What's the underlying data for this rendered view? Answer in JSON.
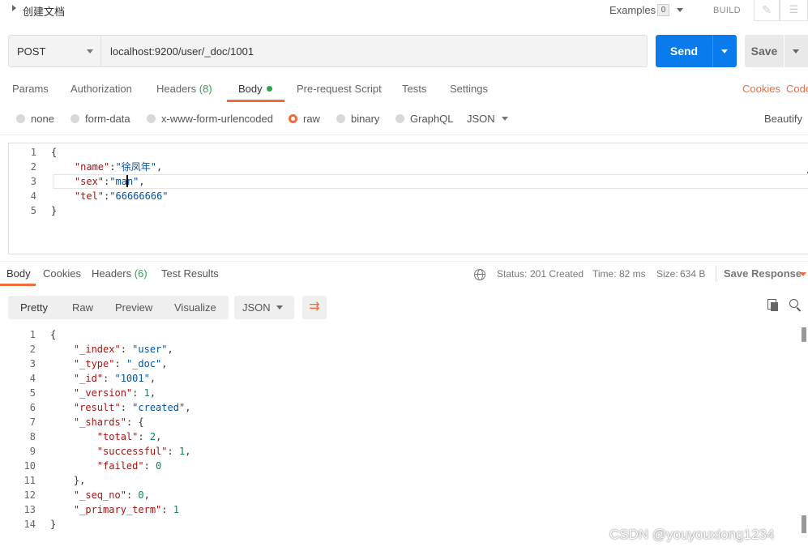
{
  "topbar": {
    "request_name": "创建文档",
    "examples_label": "Examples",
    "examples_count": "0",
    "build_label": "BUILD"
  },
  "request": {
    "method": "POST",
    "url": "localhost:9200/user/_doc/1001",
    "send_label": "Send",
    "save_label": "Save"
  },
  "request_tabs": {
    "params": "Params",
    "authorization": "Authorization",
    "headers": "Headers",
    "headers_count": "(8)",
    "body": "Body",
    "prerequest": "Pre-request Script",
    "tests": "Tests",
    "settings": "Settings",
    "cookies": "Cookies",
    "code": "Code"
  },
  "body_types": {
    "none": "none",
    "form_data": "form-data",
    "urlencoded": "x-www-form-urlencoded",
    "raw": "raw",
    "binary": "binary",
    "graphql": "GraphQL",
    "format": "JSON",
    "beautify": "Beautify"
  },
  "request_body": {
    "line_numbers": [
      "1",
      "2",
      "3",
      "4",
      "5"
    ],
    "l1": "{",
    "l2_key": "\"name\"",
    "l2_val": "\"徐凤年\"",
    "l3_key": "\"sex\"",
    "l3_val": "\"man\"",
    "l4_key": "\"tel\"",
    "l4_val": "\"66666666\"",
    "l5": "}"
  },
  "response_tabs": {
    "body": "Body",
    "cookies": "Cookies",
    "headers": "Headers",
    "headers_count": "(6)",
    "test_results": "Test Results"
  },
  "response_status": {
    "status_label": "Status:",
    "status_value": "201 Created",
    "time_label": "Time:",
    "time_value": "82 ms",
    "size_label": "Size:",
    "size_value": "634 B",
    "save_response": "Save Response"
  },
  "view_options": {
    "pretty": "Pretty",
    "raw": "Raw",
    "preview": "Preview",
    "visualize": "Visualize",
    "format": "JSON"
  },
  "response_body": {
    "line_numbers": [
      "1",
      "2",
      "3",
      "4",
      "5",
      "6",
      "7",
      "8",
      "9",
      "10",
      "11",
      "12",
      "13",
      "14"
    ],
    "open": "{",
    "index_key": "\"_index\"",
    "index_val": "\"user\"",
    "type_key": "\"_type\"",
    "type_val": "\"_doc\"",
    "id_key": "\"_id\"",
    "id_val": "\"1001\"",
    "version_key": "\"_version\"",
    "version_val": "1",
    "result_key": "\"result\"",
    "result_val": "\"created\"",
    "shards_key": "\"_shards\"",
    "total_key": "\"total\"",
    "total_val": "2",
    "successful_key": "\"successful\"",
    "successful_val": "1",
    "failed_key": "\"failed\"",
    "failed_val": "0",
    "shards_close": "},",
    "seq_key": "\"_seq_no\"",
    "seq_val": "0",
    "term_key": "\"_primary_term\"",
    "term_val": "1",
    "close": "}"
  },
  "watermark": "CSDN @youyouxiong1234"
}
